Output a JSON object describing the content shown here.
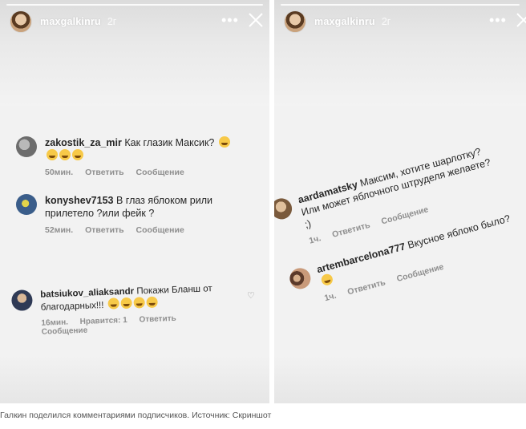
{
  "story": {
    "username": "maxgalkinru",
    "time": "2г"
  },
  "left_comments": [
    {
      "user": "zakostik_za_mir",
      "text": "Как глазик Максик?",
      "emoji_count": 4,
      "time": "50мин.",
      "reply": "Ответить",
      "message": "Сообщение"
    },
    {
      "user": "konyshev7153",
      "text": "В глаз яблоком рили прилетело ?или фейк ?",
      "time": "52мин.",
      "reply": "Ответить",
      "message": "Сообщение"
    },
    {
      "user": "batsiukov_aliaksandr",
      "text": "Покажи Бланш от благодарных!!!",
      "emoji_count": 4,
      "time": "16мин.",
      "likes": "Нравится: 1",
      "reply": "Ответить",
      "message": "Сообщение"
    }
  ],
  "right_comments": [
    {
      "user": "aardamatsky",
      "text": "Максим, хотите шарлотку? Или может яблочного штруделя желаете? ;)",
      "time": "1ч.",
      "reply": "Ответить",
      "message": "Сообщение"
    },
    {
      "user": "artembarcelona777",
      "text": "Вкусное яблоко было?",
      "emoji_count": 1,
      "time": "1ч.",
      "reply": "Ответить",
      "message": "Сообщение"
    }
  ],
  "caption": "Галкин поделился комментариями подписчиков. Источник: Скриншот",
  "icons": {
    "more": "more-dots-icon",
    "close": "close-x-icon",
    "like": "heart-icon"
  },
  "colors": {
    "text": "#262626",
    "meta": "#8e8e8e",
    "emoji": "#f7c948"
  }
}
